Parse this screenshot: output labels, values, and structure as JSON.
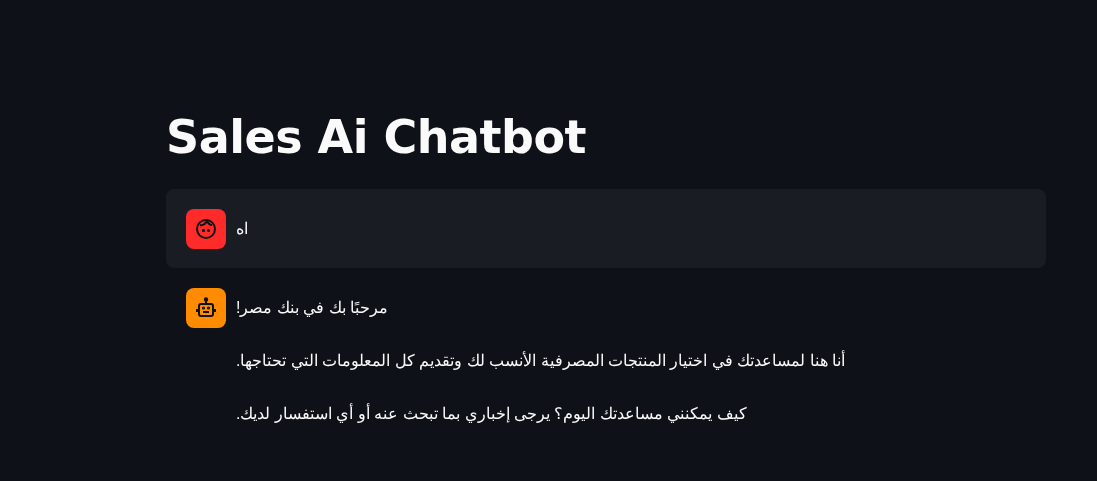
{
  "title": "Sales Ai Chatbot",
  "messages": [
    {
      "kind": "user",
      "paragraphs": [
        "اه"
      ]
    },
    {
      "kind": "assistant",
      "paragraphs": [
        "!مرحبًا بك في بنك مصر",
        ".أنا هنا لمساعدتك في اختيار المنتجات المصرفية الأنسب لك وتقديم كل المعلومات التي تحتاجها",
        ".كيف يمكنني مساعدتك اليوم؟ يرجى إخباري بما تبحث عنه أو أي استفسار لديك"
      ]
    }
  ]
}
